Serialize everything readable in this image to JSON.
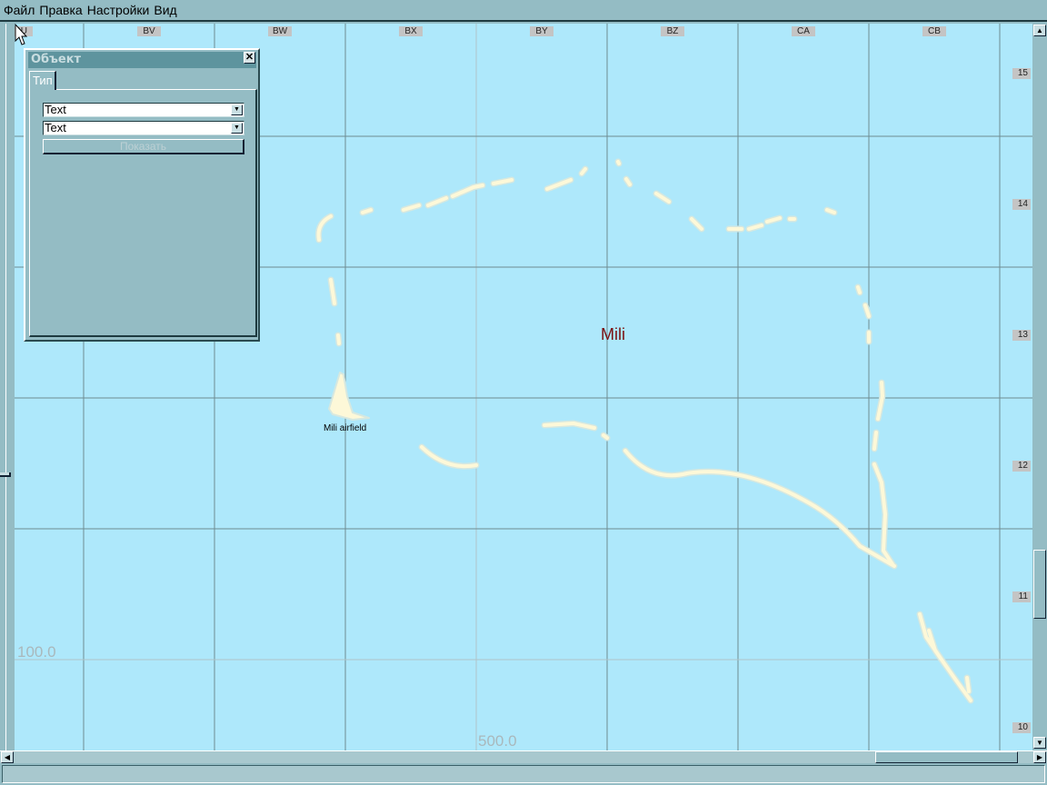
{
  "menu": [
    "Файл",
    "Правка",
    "Настройки",
    "Вид"
  ],
  "map": {
    "columns": [
      "BU",
      "BV",
      "BW",
      "BX",
      "BY",
      "BZ",
      "CA",
      "CB"
    ],
    "rows": [
      "15",
      "14",
      "13",
      "12",
      "11",
      "10"
    ],
    "coord_y_label": "100.0",
    "coord_x_label": "500.0",
    "place_label": "Mili",
    "airfield_label": "Mili airfield"
  },
  "panel": {
    "title": "Объект",
    "close": "✕",
    "tab": "Тип",
    "combo1": "Text",
    "combo2": "Text",
    "show_button": "Показать"
  },
  "colors": {
    "water": "#aee8fb",
    "land": "#fdf8d8",
    "chrome": "#94bcc4",
    "label": "#7a1010"
  }
}
